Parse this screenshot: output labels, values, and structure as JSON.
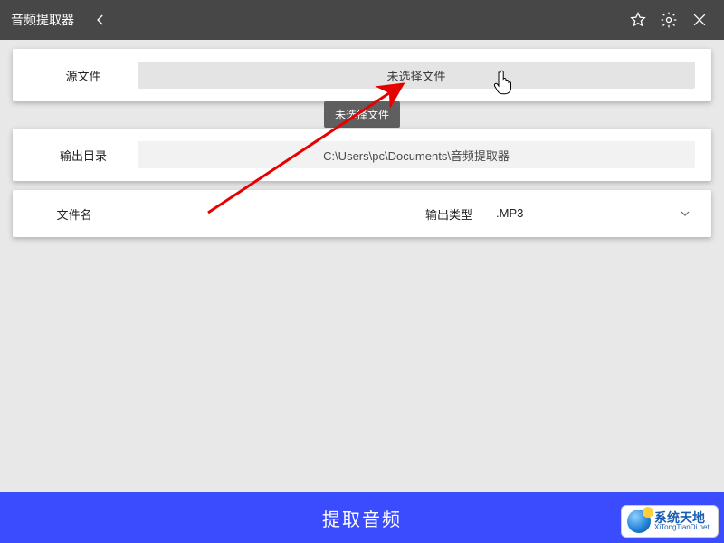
{
  "header": {
    "title": "音频提取器"
  },
  "panels": {
    "source": {
      "label": "源文件",
      "button_text": "未选择文件",
      "tooltip": "未选择文件"
    },
    "output_dir": {
      "label": "输出目录",
      "path": "C:\\Users\\pc\\Documents\\音频提取器"
    },
    "filename": {
      "label": "文件名",
      "value": ""
    },
    "output_type": {
      "label": "输出类型",
      "selected": ".MP3"
    }
  },
  "extract_button": "提取音频",
  "watermark": {
    "cn": "系统天地",
    "en": "XiTongTianDi.net"
  }
}
